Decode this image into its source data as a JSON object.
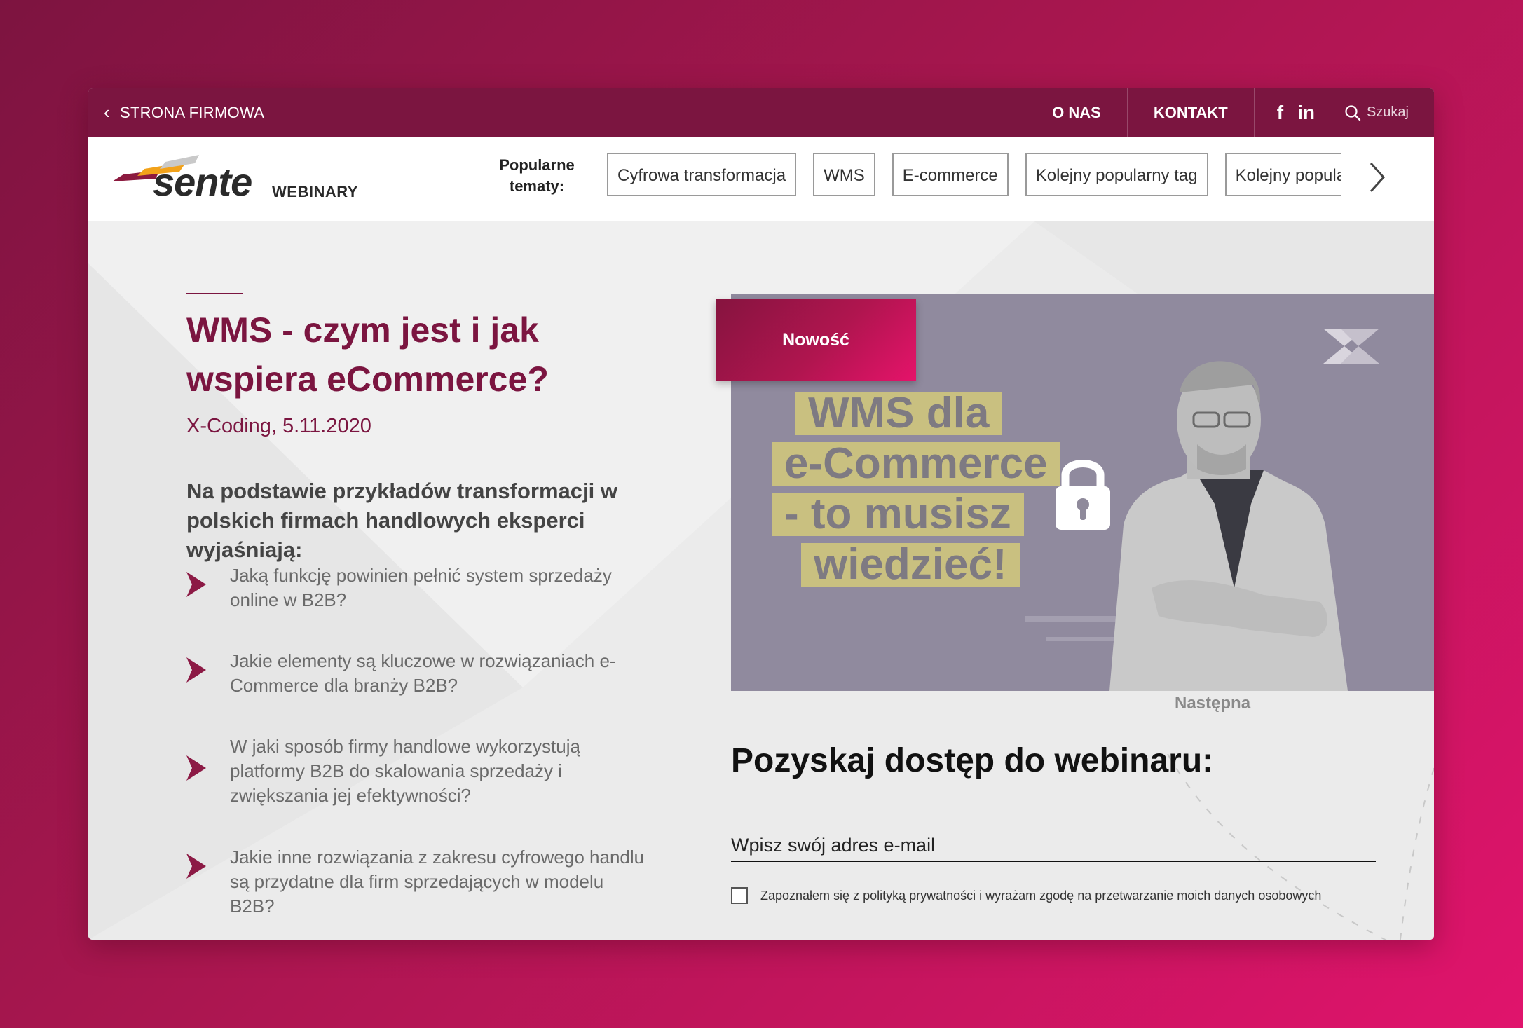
{
  "topbar": {
    "back_label": "STRONA FIRMOWA",
    "nav": [
      "O NAS",
      "KONTAKT"
    ],
    "social": [
      "f",
      "in"
    ],
    "social_icons": [
      "facebook-icon",
      "linkedin-icon"
    ],
    "search_placeholder": "Szukaj"
  },
  "header": {
    "logo_word": "sente",
    "logo_sub": "WEBINARY",
    "popular_label_line1": "Popularne",
    "popular_label_line2": "tematy:",
    "tags": [
      "Cyfrowa transformacja",
      "WMS",
      "E-commerce",
      "Kolejny popularny tag",
      "Kolejny popular"
    ]
  },
  "webinar": {
    "title": "WMS - czym jest i jak wspiera eCommerce?",
    "meta": "X-Coding, 5.11.2020",
    "intro": "Na podstawie przykładów transformacji w polskich firmach handlowych eksperci wyjaśniają:",
    "bullets": [
      "Jaką funkcję powinien pełnić system sprzedaży online w B2B?",
      "Jakie elementy są kluczowe w rozwiązaniach e-Commerce dla branży B2B?",
      "W jaki sposób firmy handlowe wykorzystują platformy B2B do skalowania sprzedaży i zwiększania jej efektywności?",
      "Jakie inne rozwiązania z zakresu cyfrowego handlu są przydatne dla firm sprzedających w modelu B2B?"
    ]
  },
  "video": {
    "badge": "Nowość",
    "headline_lines": [
      "WMS dla",
      "e-Commerce",
      "- to musisz",
      "wiedzieć!"
    ],
    "next_label": "Następna",
    "lock_icon": "lock-icon"
  },
  "form": {
    "heading": "Pozyskaj dostęp do webinaru:",
    "email_placeholder": "Wpisz swój adres e-mail",
    "consent": "Zapoznałem się z polityką prywatności i wyrażam zgodę na przetwarzanie moich danych osobowych"
  },
  "colors": {
    "brand": "#7b1540",
    "accent": "#e5136a",
    "video_bg": "#908a9e",
    "headline_highlight": "#c9c080"
  }
}
